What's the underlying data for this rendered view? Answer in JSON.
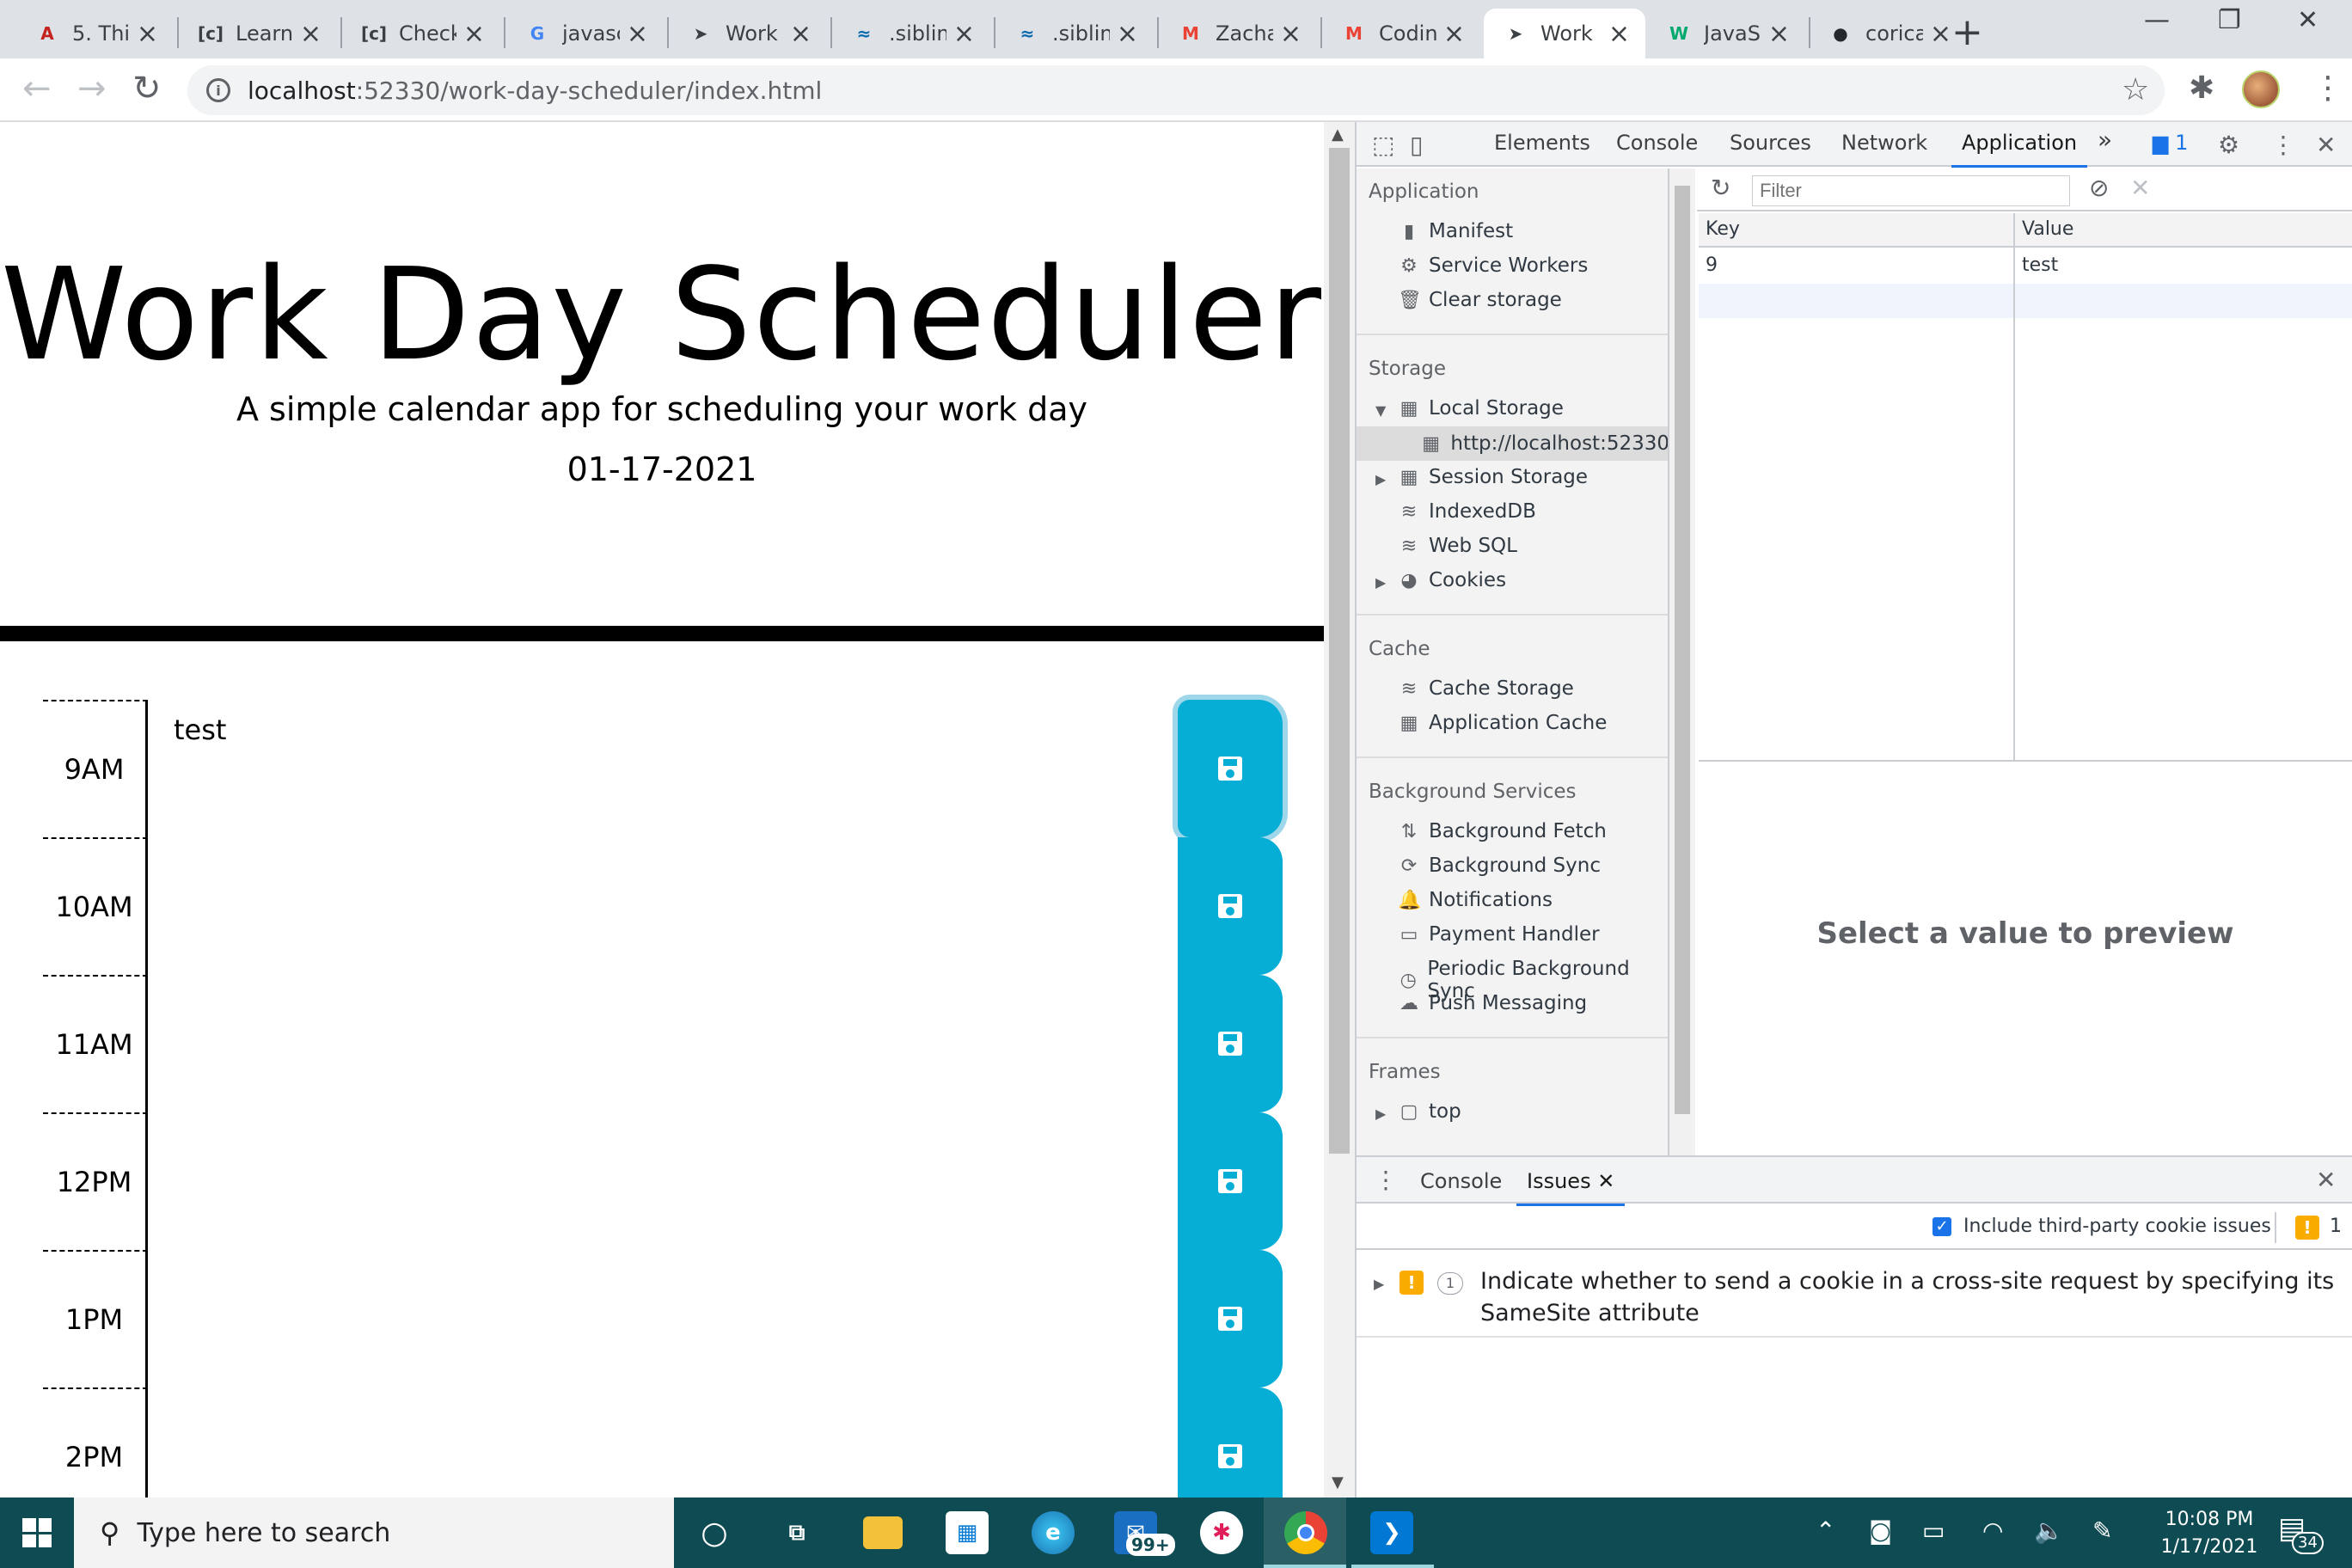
{
  "browser": {
    "tabs": [
      {
        "label": "5. Thi",
        "icon": "a-logo-icon",
        "color": "#c5221f"
      },
      {
        "label": "Learn",
        "icon": "codecademy-icon",
        "color": "#3c4043"
      },
      {
        "label": "Check",
        "icon": "codecademy-icon",
        "color": "#3c4043"
      },
      {
        "label": "javasc",
        "icon": "google-icon",
        "color": "#4285f4"
      },
      {
        "label": "Work",
        "icon": "pointer-icon",
        "color": "#3c4043"
      },
      {
        "label": ".siblin",
        "icon": "jquery-icon",
        "color": "#0769ad"
      },
      {
        "label": ".siblin",
        "icon": "jquery-icon",
        "color": "#0769ad"
      },
      {
        "label": "Zacha",
        "icon": "gmail-icon",
        "color": "#ea4335"
      },
      {
        "label": "Codin",
        "icon": "gmail-icon",
        "color": "#ea4335"
      },
      {
        "label": "Work",
        "icon": "pointer-icon",
        "color": "#3c4043",
        "active": true
      },
      {
        "label": "JavaS",
        "icon": "w3schools-icon",
        "color": "#04aa6d"
      },
      {
        "label": "corica",
        "icon": "github-icon",
        "color": "#24292e"
      }
    ],
    "url_host": "localhost",
    "url_path": ":52330/work-day-scheduler/index.html"
  },
  "page": {
    "title": "Work Day Scheduler",
    "subtitle": "A simple calendar app for scheduling your work day",
    "date": "01-17-2021",
    "rows": [
      {
        "hour": "9AM",
        "text": "test"
      },
      {
        "hour": "10AM",
        "text": ""
      },
      {
        "hour": "11AM",
        "text": ""
      },
      {
        "hour": "12PM",
        "text": ""
      },
      {
        "hour": "1PM",
        "text": ""
      },
      {
        "hour": "2PM",
        "text": ""
      }
    ],
    "accent_color": "#06aed5"
  },
  "devtools": {
    "tabs": [
      "Elements",
      "Console",
      "Sources",
      "Network",
      "Application"
    ],
    "more": "»",
    "issues_count": "1",
    "sidebar": {
      "application_header": "Application",
      "application_items": [
        "Manifest",
        "Service Workers",
        "Clear storage"
      ],
      "storage_header": "Storage",
      "local_storage": "Local Storage",
      "local_origin": "http://localhost:52330",
      "storage_items": [
        "Session Storage",
        "IndexedDB",
        "Web SQL",
        "Cookies"
      ],
      "cache_header": "Cache",
      "cache_items": [
        "Cache Storage",
        "Application Cache"
      ],
      "bg_header": "Background Services",
      "bg_items": [
        "Background Fetch",
        "Background Sync",
        "Notifications",
        "Payment Handler",
        "Periodic Background Sync",
        "Push Messaging"
      ],
      "frames_header": "Frames",
      "frames_item": "top"
    },
    "filter_placeholder": "Filter",
    "table": {
      "key_header": "Key",
      "value_header": "Value",
      "rows": [
        {
          "key": "9",
          "value": "test"
        }
      ]
    },
    "preview_text": "Select a value to preview",
    "drawer": {
      "tabs": [
        "Console",
        "Issues"
      ],
      "third_party_label": "Include third-party cookie issues",
      "warn_count": "1",
      "issue_count": "1",
      "issue_text": "Indicate whether to send a cookie in a cross-site request by specifying its SameSite attribute"
    }
  },
  "taskbar": {
    "search_placeholder": "Type here to search",
    "mail_badge": "99+",
    "time": "10:08 PM",
    "date": "1/17/2021",
    "notif_count": "34",
    "bg_color": "#0f4b52"
  }
}
